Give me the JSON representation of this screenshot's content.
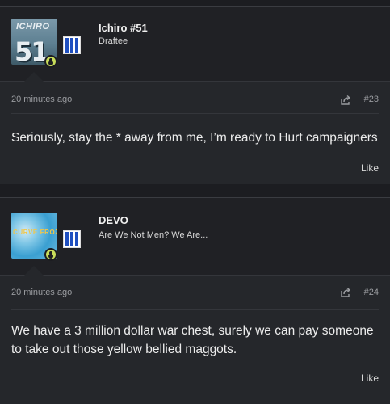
{
  "posts": [
    {
      "username": "Ichiro #51",
      "user_title": "Draftee",
      "avatar_text_top": "ICHIRO",
      "avatar_text_number": "51",
      "timestamp": "20 minutes ago",
      "post_number": "#23",
      "body": "Seriously, stay the * away from me, I’m ready to Hurt campaigners",
      "like_label": "Like"
    },
    {
      "username": "DEVO",
      "user_title": "Are We Not Men? We Are...",
      "avatar_text": "CURVE FROZEN",
      "timestamp": "20 minutes ago",
      "post_number": "#24",
      "body": "We have a 3 million dollar war chest, surely we can pay someone to take out those yellow bellied maggots.",
      "like_label": "Like"
    }
  ],
  "colors": {
    "background": "#1c1d21",
    "post_background": "#25272b",
    "status_dot": "#c7dc5a",
    "flair_stripe": "#1f4fbf"
  },
  "icons": [
    "share-icon",
    "user-status-icon"
  ]
}
